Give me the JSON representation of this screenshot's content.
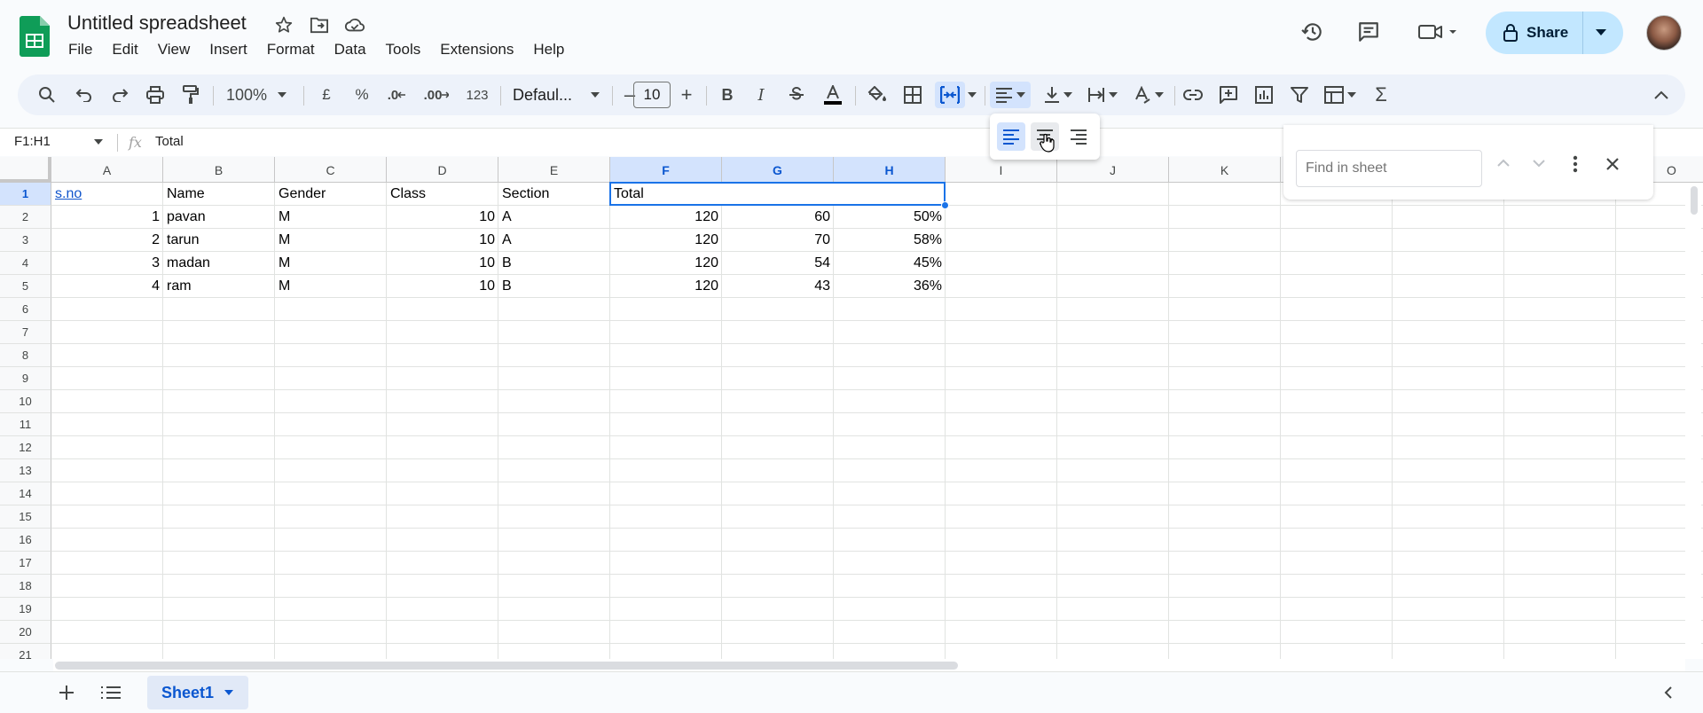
{
  "header": {
    "title": "Untitled spreadsheet",
    "menu": [
      "File",
      "Edit",
      "View",
      "Insert",
      "Format",
      "Data",
      "Tools",
      "Extensions",
      "Help"
    ],
    "share_label": "Share"
  },
  "toolbar": {
    "zoom": "100%",
    "currency": "£",
    "percent": "%",
    "dec_decrease": ".0",
    "dec_increase": ".00",
    "format_123": "123",
    "font": "Defaul...",
    "font_size": "10",
    "minus": "–",
    "plus": "+",
    "bold": "B",
    "italic": "I",
    "sum": "Σ"
  },
  "formula_bar": {
    "name_box": "F1:H1",
    "fx": "fx",
    "value": "Total"
  },
  "grid": {
    "columns": [
      "A",
      "B",
      "C",
      "D",
      "E",
      "F",
      "G",
      "H",
      "I",
      "J",
      "K",
      "",
      "",
      "",
      "O"
    ],
    "selected_columns": [
      "F",
      "G",
      "H"
    ],
    "rows": [
      "1",
      "2",
      "3",
      "4",
      "5",
      "6",
      "7",
      "8",
      "9",
      "10",
      "11",
      "12",
      "13",
      "14",
      "15",
      "16",
      "17",
      "18",
      "19",
      "20",
      "21"
    ],
    "selected_row": "1",
    "cells": {
      "r1": [
        "s.no",
        "Name",
        "Gender",
        "Class",
        "Section",
        "Total"
      ],
      "r2": [
        "1",
        "pavan",
        "M",
        "10",
        "A",
        "120",
        "60",
        "50%"
      ],
      "r3": [
        "2",
        "tarun",
        "M",
        "10",
        "A",
        "120",
        "70",
        "58%"
      ],
      "r4": [
        "3",
        "madan",
        "M",
        "10",
        "B",
        "120",
        "54",
        "45%"
      ],
      "r5": [
        "4",
        "ram",
        "M",
        "10",
        "B",
        "120",
        "43",
        "36%"
      ]
    }
  },
  "find": {
    "placeholder": "Find in sheet"
  },
  "bottom": {
    "sheet_name": "Sheet1"
  },
  "colors": {
    "accent": "#0b57d0",
    "share_bg": "#c2e7ff",
    "selection": "#1a73e8",
    "header_selected": "#d3e3fd",
    "logo_green": "#0f9d58"
  }
}
